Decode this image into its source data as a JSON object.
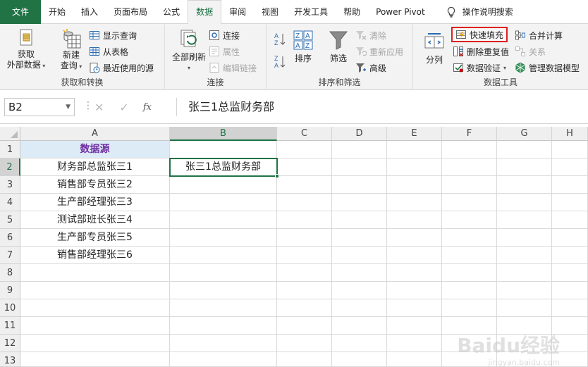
{
  "menu": {
    "tabs": [
      "文件",
      "开始",
      "插入",
      "页面布局",
      "公式",
      "数据",
      "审阅",
      "视图",
      "开发工具",
      "帮助",
      "Power Pivot"
    ],
    "active_tab": "数据",
    "search_label": "操作说明搜索"
  },
  "ribbon": {
    "get_transform": {
      "get_external_line1": "获取",
      "get_external_line2": "外部数据",
      "new_query_line1": "新建",
      "new_query_line2": "查询",
      "show_queries": "显示查询",
      "from_table": "从表格",
      "recent_sources": "最近使用的源",
      "label": "获取和转换"
    },
    "connections": {
      "refresh_all": "全部刷新",
      "connections": "连接",
      "properties": "属性",
      "edit_links": "编辑链接",
      "label": "连接"
    },
    "sort_filter": {
      "sort": "排序",
      "filter": "筛选",
      "clear": "清除",
      "reapply": "重新应用",
      "advanced": "高级",
      "label": "排序和筛选"
    },
    "data_tools": {
      "text_to_columns": "分列",
      "flash_fill": "快速填充",
      "remove_duplicates": "删除重复值",
      "data_validation": "数据验证",
      "consolidate": "合并计算",
      "relationships": "关系",
      "manage_data_model": "管理数据模型",
      "label": "数据工具"
    }
  },
  "formula_bar": {
    "name_box": "B2",
    "formula": "张三1总监财务部",
    "fx": "fx"
  },
  "sheet": {
    "columns": [
      "A",
      "B",
      "C",
      "D",
      "E",
      "F",
      "G",
      "H"
    ],
    "rows": [
      "1",
      "2",
      "3",
      "4",
      "5",
      "6",
      "7",
      "8",
      "9",
      "10",
      "11",
      "12",
      "13"
    ],
    "selected_cell": "B2",
    "A1": "数据源",
    "A2": "财务部总监张三1",
    "A3": "销售部专员张三2",
    "A4": "生产部经理张三3",
    "A5": "测试部班长张三4",
    "A6": "生产部专员张三5",
    "A7": "销售部经理张三6",
    "B2": "张三1总监财务部"
  },
  "watermark": {
    "logo": "Baidu经验",
    "url": "jingyan.baidu.com"
  },
  "colors": {
    "excel_green": "#217346",
    "header_fill": "#ddebf7",
    "header_text": "#7030a0",
    "highlight_red": "#e02020"
  }
}
